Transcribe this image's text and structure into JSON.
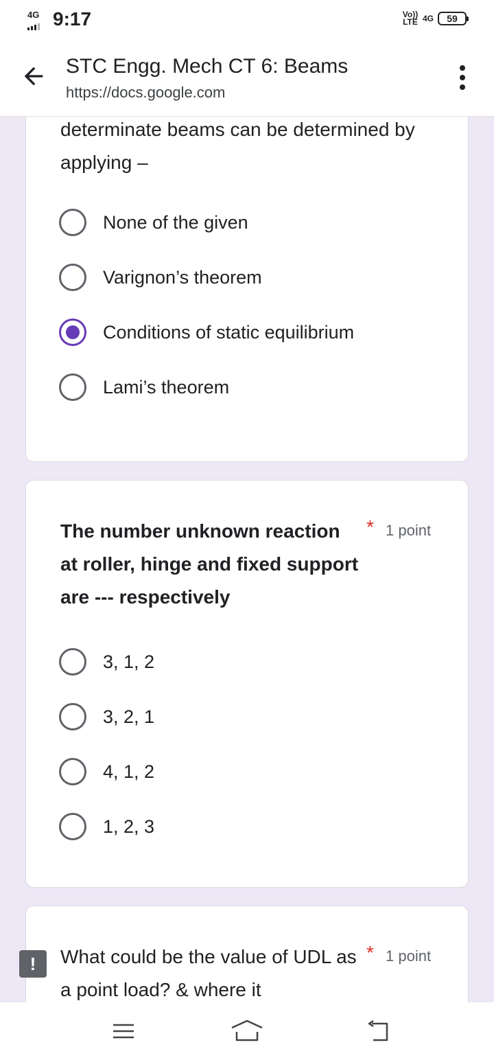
{
  "status_bar": {
    "network_left": "4G",
    "time": "9:17",
    "volte": "Vo)) LTE",
    "network_right": "4G",
    "battery": "59"
  },
  "app_bar": {
    "title": "STC Engg. Mech CT 6: Beams",
    "url": "https://docs.google.com"
  },
  "question_1": {
    "text_continued": "determinate beams can be determined by applying –",
    "options": [
      {
        "label": "None of the given",
        "selected": false
      },
      {
        "label": "Varignon’s theorem",
        "selected": false
      },
      {
        "label": "Conditions of static equilibrium",
        "selected": true
      },
      {
        "label": "Lami’s theorem",
        "selected": false
      }
    ]
  },
  "question_2": {
    "title": "The number unknown reaction at roller, hinge and fixed support are --- respectively",
    "required_mark": "*",
    "points": "1 point",
    "options": [
      {
        "label": "3, 1, 2",
        "selected": false
      },
      {
        "label": "3, 2, 1",
        "selected": false
      },
      {
        "label": "4, 1, 2",
        "selected": false
      },
      {
        "label": "1, 2, 3",
        "selected": false
      }
    ]
  },
  "question_3": {
    "title": "What could be the value of UDL as a point load? & where it",
    "required_mark": "*",
    "points": "1 point",
    "error_icon": "!"
  },
  "colors": {
    "accent": "#673ab7",
    "background": "#ede7f6",
    "required": "#d93025"
  },
  "icons": {
    "back": "arrow-back-icon",
    "menu": "more-vert-icon",
    "recents": "recents-icon",
    "home": "home-icon",
    "back_nav": "back-nav-icon"
  }
}
